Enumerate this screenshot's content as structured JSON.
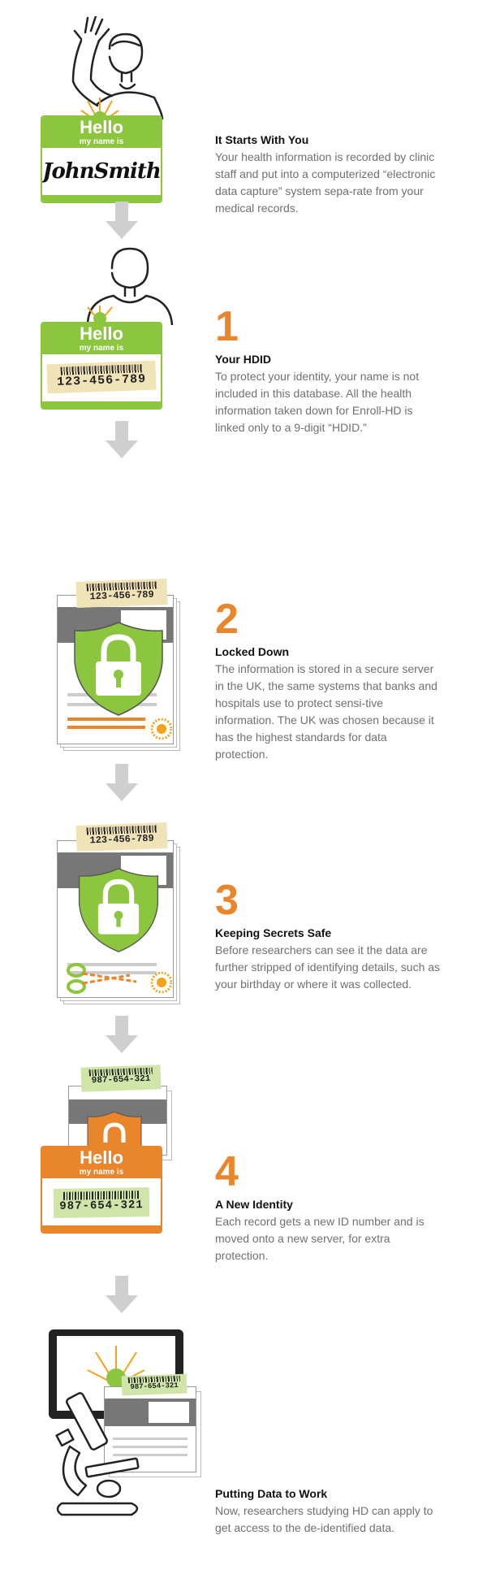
{
  "steps": [
    {
      "number": "",
      "title": "It Starts With You",
      "body": "Your health information is recorded by clinic staff and put into a computerized “electronic data capture” system sepa-rate from your medical records."
    },
    {
      "number": "1",
      "title": "Your HDID",
      "body": "To protect your identity, your name is not included in this database. All the health information taken down for Enroll-HD is linked only to a 9-digit “HDID.”"
    },
    {
      "number": "2",
      "title": "Locked Down",
      "body": "The information is stored in a secure server in the UK, the same systems that banks and hospitals use to protect sensi-tive information. The UK was chosen because it has the highest standards for data protection."
    },
    {
      "number": "3",
      "title": "Keeping Secrets Safe",
      "body": "Before researchers can see it the data are further stripped of identifying details, such as your birthday or where it was collected."
    },
    {
      "number": "4",
      "title": "A New Identity",
      "body": "Each record gets a new ID number and is moved onto a new server, for extra protection."
    },
    {
      "number": "",
      "title": "Putting Data to Work",
      "body": "Now, researchers studying HD can apply to get access to the de-identified data."
    }
  ],
  "badge": {
    "hello": "Hello",
    "sub": "my name is",
    "name": "JohnSmith"
  },
  "ids": {
    "hdid": "123-456-789",
    "new_id": "987-654-321"
  },
  "colors": {
    "green": "#8cc63f",
    "orange": "#e9852a",
    "arrow": "#cfcfcf",
    "text": "#707070",
    "title": "#111111"
  },
  "icons": [
    "waving-man-icon",
    "standing-man-icon",
    "sunburst-logo-icon",
    "document-stack-icon",
    "shield-lock-icon",
    "scissors-icon",
    "microscope-icon",
    "computer-monitor-icon",
    "down-arrow-icon"
  ]
}
